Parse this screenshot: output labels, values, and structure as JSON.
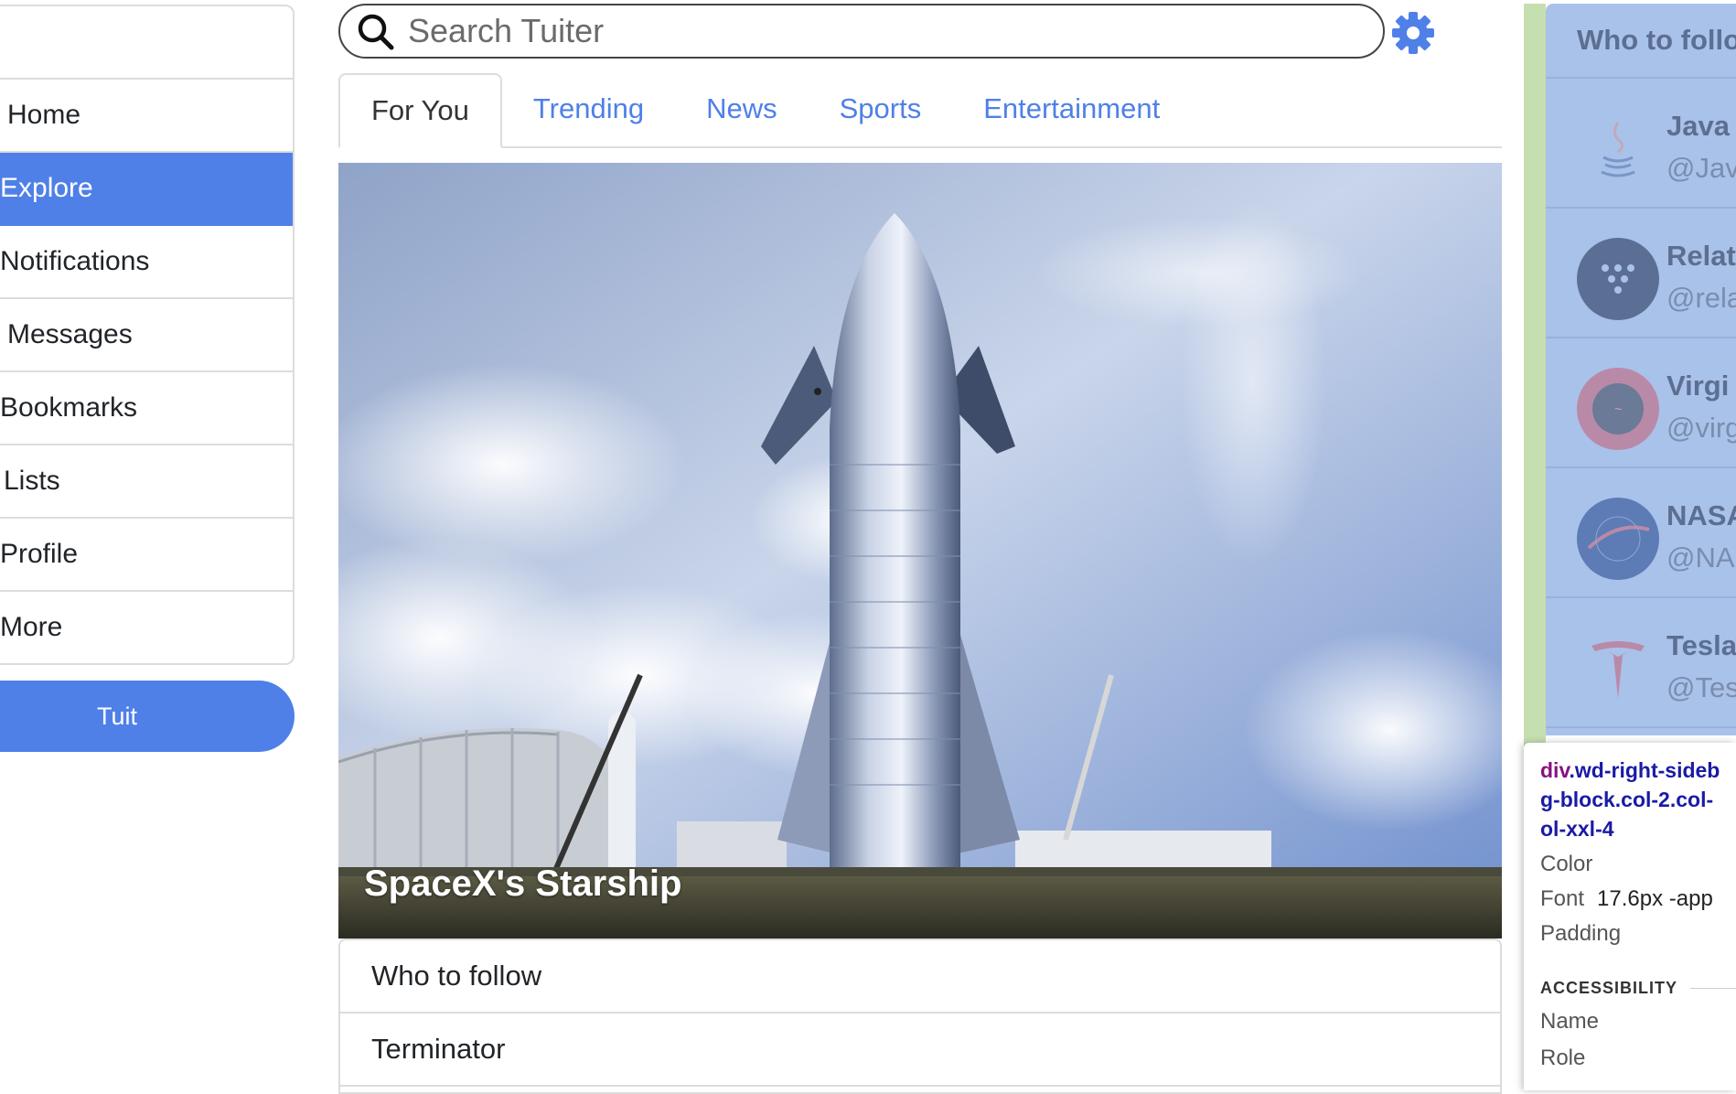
{
  "nav": {
    "items": [
      {
        "label": "Home",
        "active": false
      },
      {
        "label": "Explore",
        "active": true
      },
      {
        "label": "Notifications",
        "active": false
      },
      {
        "label": "Messages",
        "active": false
      },
      {
        "label": "Bookmarks",
        "active": false
      },
      {
        "label": "Lists",
        "active": false
      },
      {
        "label": "Profile",
        "active": false
      },
      {
        "label": "More",
        "active": false
      }
    ],
    "tuit_button": "Tuit"
  },
  "search": {
    "placeholder": "Search Tuiter"
  },
  "tabs": [
    {
      "label": "For You",
      "active": true
    },
    {
      "label": "Trending",
      "active": false
    },
    {
      "label": "News",
      "active": false
    },
    {
      "label": "Sports",
      "active": false
    },
    {
      "label": "Entertainment",
      "active": false
    }
  ],
  "hero": {
    "caption": "SpaceX's Starship"
  },
  "main_list": {
    "rows": [
      "Who to follow",
      "Terminator"
    ]
  },
  "right_sidebar": {
    "header": "Who to follo",
    "accounts": [
      {
        "name": "Java",
        "handle": "@Jav",
        "icon": "java-logo-icon"
      },
      {
        "name": "Relat",
        "handle": "@rela",
        "icon": "relativity-logo-icon"
      },
      {
        "name": "Virgi",
        "handle": "@virg",
        "icon": "virgin-logo-icon"
      },
      {
        "name": "NASA",
        "handle": "@NAS",
        "icon": "nasa-logo-icon"
      },
      {
        "name": "Tesla",
        "handle": "@Tes",
        "icon": "tesla-logo-icon"
      }
    ]
  },
  "devtools": {
    "selector_tag": "div",
    "selector_line1": ".wd-right-sideb",
    "selector_line2": "g-block.col-2.col-",
    "selector_line3": "ol-xxl-4",
    "color_label": "Color",
    "font_label": "Font",
    "font_value": "17.6px -app",
    "padding_label": "Padding",
    "section_title": "ACCESSIBILITY",
    "name_label": "Name",
    "role_label": "Role"
  },
  "colors": {
    "accent": "#4f80e8",
    "sidebar_overlay": "#a9c2ea",
    "green_strip": "#c6dfb0"
  }
}
